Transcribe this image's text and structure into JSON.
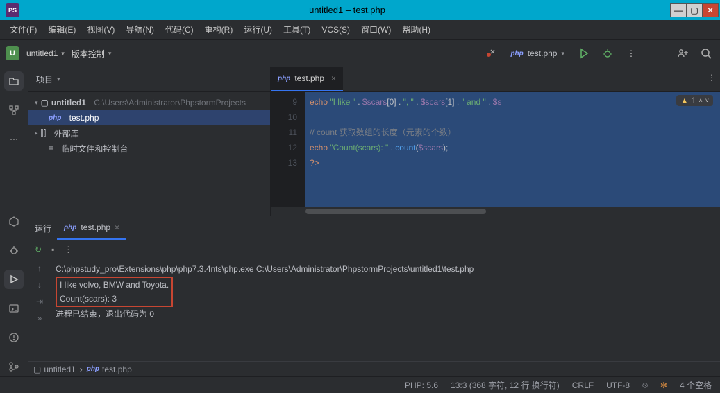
{
  "window": {
    "title": "untitled1 – test.php"
  },
  "menubar": [
    "文件(F)",
    "编辑(E)",
    "视图(V)",
    "导航(N)",
    "代码(C)",
    "重构(R)",
    "运行(U)",
    "工具(T)",
    "VCS(S)",
    "窗口(W)",
    "帮助(H)"
  ],
  "toolbar": {
    "project": "untitled1",
    "vcs": "版本控制",
    "run_config": "test.php"
  },
  "project_panel": {
    "title": "项目",
    "root": "untitled1",
    "root_path": "C:\\Users\\Administrator\\PhpstormProjects",
    "file": "test.php",
    "ext_lib": "外部库",
    "scratch": "临时文件和控制台"
  },
  "editor": {
    "tab": "test.php",
    "warn_count": "1",
    "gutter": [
      "9",
      "10",
      "11",
      "12",
      "13"
    ],
    "lines": [
      {
        "raw": "    echo \"I like \" . $scars[0] . \", \" . $scars[1] . \" and \" . $s"
      },
      {
        "raw": ""
      },
      {
        "raw": "    // count 获取数组的长度（元素的个数）"
      },
      {
        "raw": "    echo \"Count(scars): \" . count($scars);"
      },
      {
        "raw": "    ?>"
      }
    ]
  },
  "run": {
    "label": "运行",
    "tab": "test.php",
    "cmd": "C:\\phpstudy_pro\\Extensions\\php\\php7.3.4nts\\php.exe C:\\Users\\Administrator\\PhpstormProjects\\untitled1\\test.php",
    "out1": "I like volvo, BMW and Toyota.",
    "out2": "Count(scars): 3",
    "exit": "进程已结束，退出代码为 0"
  },
  "breadcrumb": {
    "project": "untitled1",
    "file": "test.php"
  },
  "status": {
    "php": "PHP: 5.6",
    "pos": "13:3 (368 字符, 12 行 换行符)",
    "le": "CRLF",
    "enc": "UTF-8",
    "spaces": "4 个空格"
  }
}
